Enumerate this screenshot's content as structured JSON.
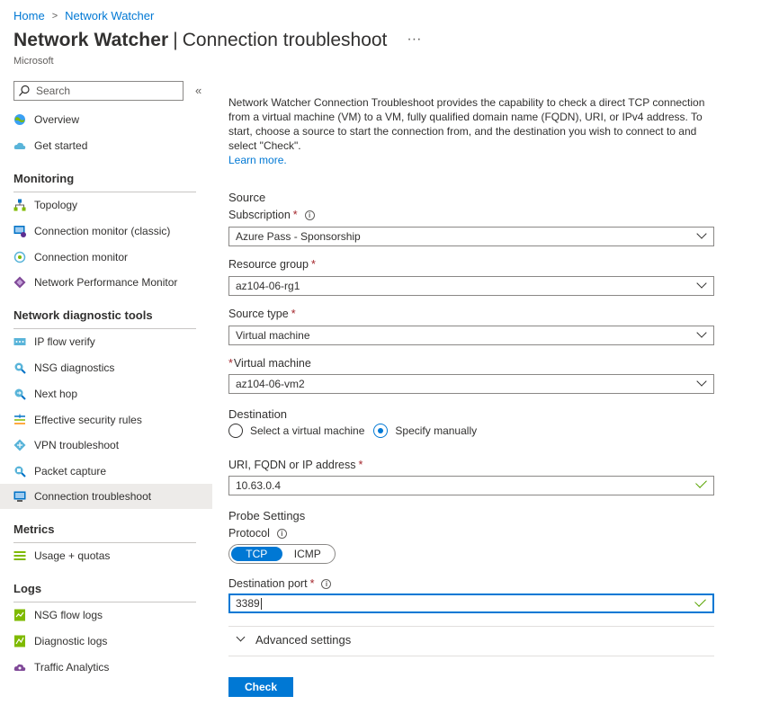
{
  "breadcrumb": {
    "home": "Home",
    "current": "Network Watcher",
    "separator": ">"
  },
  "header": {
    "title": "Network Watcher",
    "divider": "|",
    "subtitle": "Connection troubleshoot",
    "more": "···",
    "org": "Microsoft"
  },
  "sidebar": {
    "search_placeholder": "Search",
    "collapse": "«",
    "top_items": [
      {
        "label": "Overview",
        "icon": "globe-icon"
      },
      {
        "label": "Get started",
        "icon": "cloud-icon"
      }
    ],
    "sections": [
      {
        "heading": "Monitoring",
        "items": [
          {
            "label": "Topology",
            "icon": "topology-icon"
          },
          {
            "label": "Connection monitor (classic)",
            "icon": "monitor-icon"
          },
          {
            "label": "Connection monitor",
            "icon": "connection-monitor-icon"
          },
          {
            "label": "Network Performance Monitor",
            "icon": "diamond-icon"
          }
        ]
      },
      {
        "heading": "Network diagnostic tools",
        "items": [
          {
            "label": "IP flow verify",
            "icon": "ip-flow-icon"
          },
          {
            "label": "NSG diagnostics",
            "icon": "nsg-icon"
          },
          {
            "label": "Next hop",
            "icon": "next-hop-icon"
          },
          {
            "label": "Effective security rules",
            "icon": "security-rules-icon"
          },
          {
            "label": "VPN troubleshoot",
            "icon": "vpn-icon"
          },
          {
            "label": "Packet capture",
            "icon": "packet-capture-icon"
          },
          {
            "label": "Connection troubleshoot",
            "icon": "connection-troubleshoot-icon"
          }
        ]
      },
      {
        "heading": "Metrics",
        "items": [
          {
            "label": "Usage + quotas",
            "icon": "usage-icon"
          }
        ]
      },
      {
        "heading": "Logs",
        "items": [
          {
            "label": "NSG flow logs",
            "icon": "flow-logs-icon"
          },
          {
            "label": "Diagnostic logs",
            "icon": "diagnostic-logs-icon"
          },
          {
            "label": "Traffic Analytics",
            "icon": "traffic-analytics-icon"
          }
        ]
      }
    ]
  },
  "main": {
    "intro": "Network Watcher Connection Troubleshoot provides the capability to check a direct TCP connection from a virtual machine (VM) to a VM, fully qualified domain name (FQDN), URI, or IPv4 address. To start, choose a source to start the connection from, and the destination you wish to connect to and select \"Check\".",
    "learn_more": "Learn more.",
    "source": {
      "heading": "Source",
      "subscription_label": "Subscription",
      "subscription_value": "Azure Pass - Sponsorship",
      "resource_group_label": "Resource group",
      "resource_group_value": "az104-06-rg1",
      "source_type_label": "Source type",
      "source_type_value": "Virtual machine",
      "vm_label": "Virtual machine",
      "vm_value": "az104-06-vm2"
    },
    "destination": {
      "heading": "Destination",
      "option_vm": "Select a virtual machine",
      "option_manual": "Specify manually",
      "address_label": "URI, FQDN or IP address",
      "address_value": "10.63.0.4"
    },
    "probe": {
      "heading": "Probe Settings",
      "protocol_label": "Protocol",
      "protocol_tcp": "TCP",
      "protocol_icmp": "ICMP",
      "port_label": "Destination port",
      "port_value": "3389"
    },
    "advanced": "Advanced settings",
    "check_button": "Check",
    "required_mark": "*",
    "info_mark": "i"
  }
}
